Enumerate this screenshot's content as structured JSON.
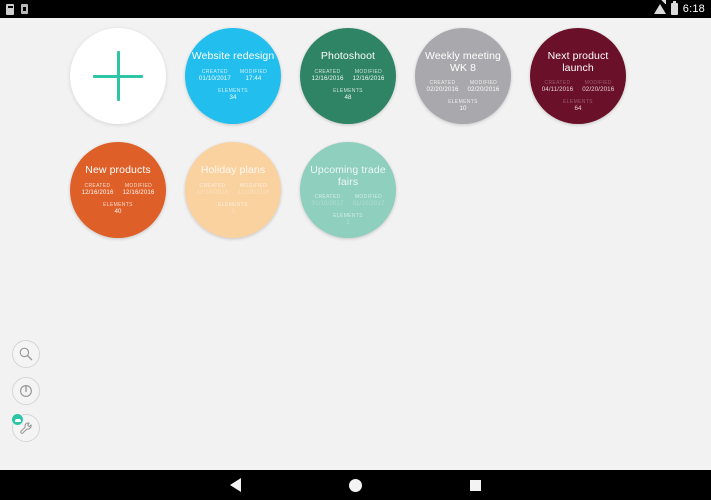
{
  "statusbar": {
    "clock": "6:18",
    "icons_left": [
      "notification-icon",
      "sim-card-icon"
    ],
    "icons_right": [
      "wifi-icon",
      "battery-icon"
    ]
  },
  "labels": {
    "created": "CREATED",
    "modified": "MODIFIED",
    "elements": "ELEMENTS"
  },
  "add_button": {
    "name": "add-new-board-button",
    "icon": "plus-icon"
  },
  "boards": [
    {
      "title": "Website redesign",
      "created": "01/10/2017",
      "modified": "17:44",
      "elements": "34",
      "color": "#22BEEE",
      "style": "normal"
    },
    {
      "title": "Photoshoot",
      "created": "12/16/2016",
      "modified": "12/16/2016",
      "elements": "48",
      "color": "#2E8465",
      "style": "normal"
    },
    {
      "title": "Weekly meeting WK 8",
      "created": "02/20/2016",
      "modified": "02/20/2016",
      "elements": "10",
      "color": "#A9A9AD",
      "style": "normal"
    },
    {
      "title": "Next product launch",
      "created": "04/11/2016",
      "modified": "02/20/2016",
      "elements": "64",
      "color": "#6B1029",
      "style": "dim"
    },
    {
      "title": "New products",
      "created": "12/16/2016",
      "modified": "12/16/2016",
      "elements": "40",
      "color": "#DE5F28",
      "style": "normal"
    },
    {
      "title": "Holiday plans",
      "created": "12/16/2016",
      "modified": "12/16/2016",
      "elements": "3",
      "color": "#FAD2A0",
      "style": "faded"
    },
    {
      "title": "Upcoming trade fairs",
      "created": "01/10/2017",
      "modified": "01/10/2017",
      "elements": "1",
      "color": "#8ECFBE",
      "style": "faded"
    }
  ],
  "tools": [
    {
      "name": "search-button",
      "icon": "search-icon"
    },
    {
      "name": "power-button",
      "icon": "power-icon"
    },
    {
      "name": "settings-button",
      "icon": "wrench-icon",
      "badge": true
    }
  ],
  "navbar": {
    "back": "back-icon",
    "home": "home-icon",
    "recents": "recents-icon"
  }
}
